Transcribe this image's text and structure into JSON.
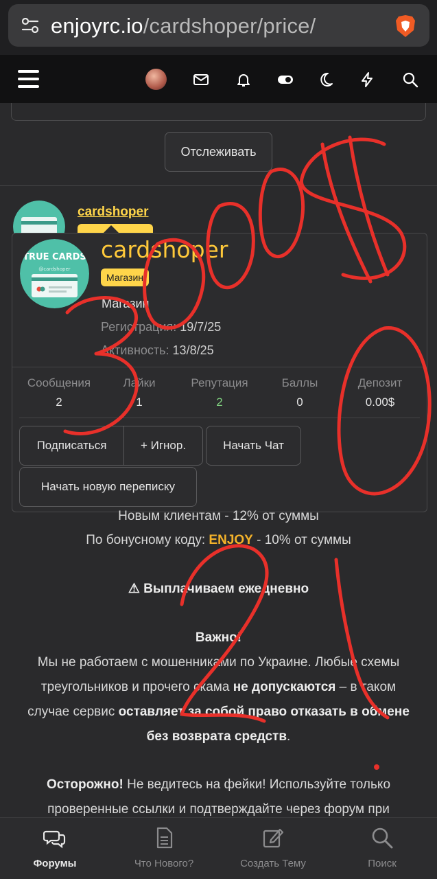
{
  "browser": {
    "url_host": "enjoyrc.io",
    "url_path": "/cardshoper/price/"
  },
  "header": {
    "icons": [
      "menu-icon",
      "avatar",
      "mail-icon",
      "bell-icon",
      "toggle-icon",
      "moon-icon",
      "bolt-icon",
      "search-icon"
    ]
  },
  "top": {
    "follow_label": "Отслеживать"
  },
  "post": {
    "author": "cardshoper",
    "avatar_caption": "TRUE CARDS"
  },
  "profile": {
    "name": "cardshoper",
    "badge": "Магазин",
    "title": "Магазин",
    "reg_label": "Регистрация:",
    "reg_value": "19/7/25",
    "act_label": "Активность:",
    "act_value": "13/8/25",
    "avatar_caption": "TRUE CARDS",
    "avatar_handle": "@cardshoper",
    "stats": [
      {
        "label": "Сообщения",
        "value": "2"
      },
      {
        "label": "Лайки",
        "value": "1"
      },
      {
        "label": "Репутация",
        "value": "2"
      },
      {
        "label": "Баллы",
        "value": "0"
      },
      {
        "label": "Депозит",
        "value": "0.00$"
      }
    ],
    "btn_subscribe": "Подписаться",
    "btn_ignore": "+ Игнор.",
    "btn_chat": "Начать Чат",
    "btn_conversation": "Начать новую переписку"
  },
  "article": {
    "line_new_clients": "Новым клиентам - 12% от суммы",
    "bonus_prefix": "По бонусному коду: ",
    "bonus_code": "ENJOY",
    "bonus_suffix": " - 10% от суммы",
    "daily": "⚠ Выплачиваем ежедневно",
    "important": "Важно!",
    "p1_l1": "Мы не работаем с мошенниками по Украине. Любые схемы",
    "p1_l2_a": "треугольников и прочего скама ",
    "p1_l2_b": "не допускаются",
    "p1_l2_c": " – в таком",
    "p1_l3_a": "случае сервис ",
    "p1_l3_b": "оставляет за собой право отказать в обмене",
    "p1_l4_a": "без возврата средств",
    "p1_l4_b": ".",
    "p2_l1_a": "Осторожно!",
    "p2_l1_b": " Не ведитесь на фейки! Используйте только",
    "p2_l2": "проверенные ссылки и подтверждайте через форум при"
  },
  "bottom_nav": {
    "items": [
      {
        "label": "Форумы",
        "icon": "comments-icon"
      },
      {
        "label": "Что Нового?",
        "icon": "document-icon"
      },
      {
        "label": "Создать Тему",
        "icon": "edit-icon"
      },
      {
        "label": "Поиск",
        "icon": "search-icon"
      }
    ]
  },
  "colors": {
    "accent_yellow": "#ffd54a",
    "scribble_red": "#e8302a"
  }
}
